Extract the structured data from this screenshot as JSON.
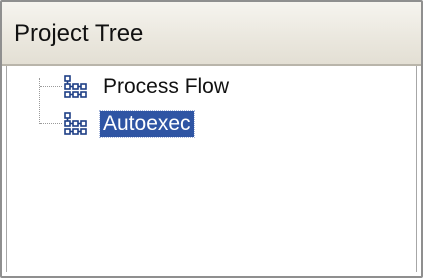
{
  "panel": {
    "title": "Project Tree"
  },
  "tree": {
    "items": [
      {
        "label": "Process Flow",
        "icon": "process-flow-icon",
        "selected": false
      },
      {
        "label": "Autoexec",
        "icon": "process-flow-icon",
        "selected": true
      }
    ]
  },
  "colors": {
    "header_background": "#ebe8df",
    "selection_background": "#2f55a4",
    "selection_text": "#ffffff",
    "icon_blue": "#1e3f86"
  }
}
